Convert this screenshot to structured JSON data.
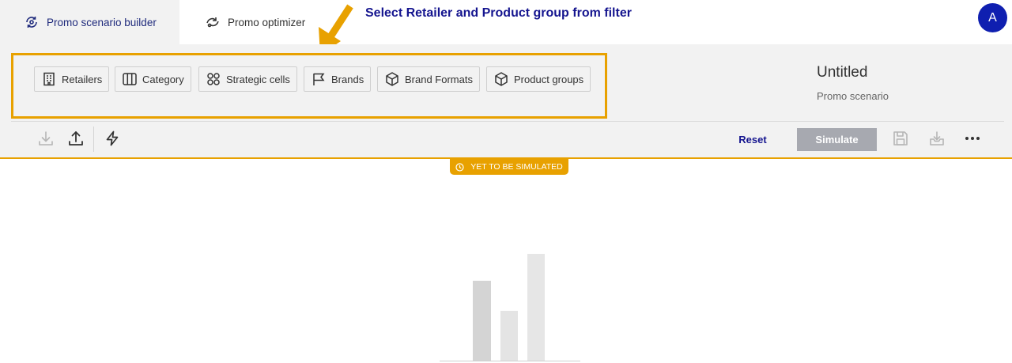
{
  "tabs": [
    {
      "label": "Promo scenario builder",
      "icon": "promo-builder-icon",
      "active": true
    },
    {
      "label": "Promo optimizer",
      "icon": "promo-optimizer-icon",
      "active": false
    }
  ],
  "user": {
    "avatar_initial": "A",
    "avatar_color": "#0f1fb0"
  },
  "annotation": {
    "text": "Select Retailer and Product group from filter",
    "color": "#e8a100"
  },
  "filters": [
    {
      "label": "Retailers",
      "icon": "building-icon"
    },
    {
      "label": "Category",
      "icon": "columns-icon"
    },
    {
      "label": "Strategic cells",
      "icon": "grid-circles-icon"
    },
    {
      "label": "Brands",
      "icon": "flag-icon"
    },
    {
      "label": "Brand Formats",
      "icon": "cube-icon"
    },
    {
      "label": "Product groups",
      "icon": "cube-icon"
    }
  ],
  "scenario": {
    "title": "Untitled",
    "subtitle": "Promo scenario"
  },
  "toolbar": {
    "icons": [
      "download-icon",
      "upload-icon",
      "lightning-icon"
    ],
    "reset_label": "Reset",
    "simulate_label": "Simulate",
    "right_icons": [
      "save-icon",
      "inbox-download-icon",
      "more-icon"
    ]
  },
  "status": {
    "label": "YET TO BE SIMULATED",
    "color": "#e8a100"
  },
  "colors": {
    "accent": "#15158f",
    "highlight": "#e8a100",
    "simulate_disabled": "#a7a9b0"
  }
}
